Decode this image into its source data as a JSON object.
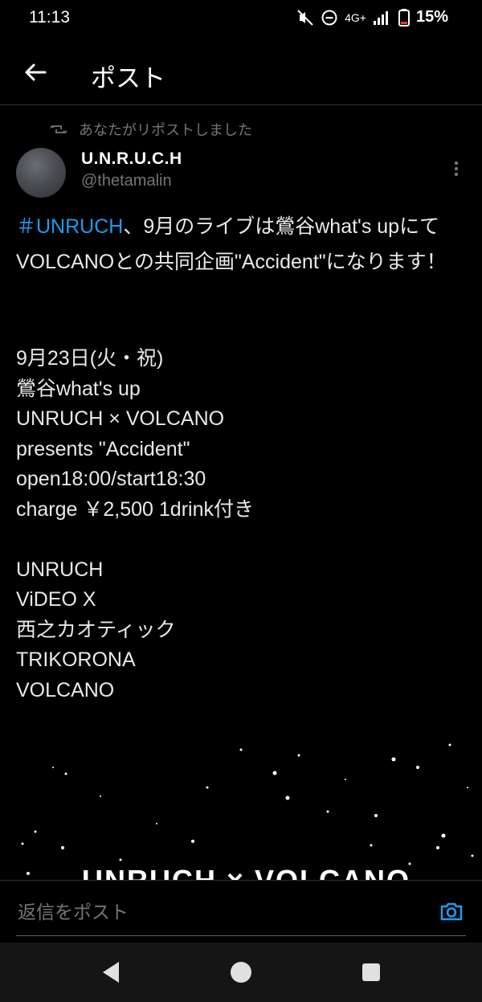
{
  "status_bar": {
    "time": "11:13",
    "network": "4G+",
    "battery": "15%"
  },
  "header": {
    "title": "ポスト"
  },
  "repost": {
    "text": "あなたがリポストしました"
  },
  "author": {
    "name": "U.N.R.U.C.H",
    "handle": "@thetamalin"
  },
  "tweet": {
    "hashtag": "＃UNRUCH",
    "intro": "、9月のライブは鶯谷what's upにてVOLCANOとの共同企画\"Accident\"になります！",
    "event_lines": [
      "9月23日(火・祝)",
      "鶯谷what's up",
      "UNRUCH × VOLCANO",
      "presents \"Accident\"",
      "open18:00/start18:30",
      "charge ￥2,500 1drink付き"
    ],
    "lineup": [
      "UNRUCH",
      "ViDEO X",
      "西之カオティック",
      "TRIKORONA",
      "VOLCANO"
    ]
  },
  "media": {
    "title_text": "UNRUCH × VOLCANO"
  },
  "reply": {
    "placeholder": "返信をポスト"
  },
  "colors": {
    "accent": "#1d9bf0",
    "muted": "#71767b",
    "background": "#000000"
  }
}
